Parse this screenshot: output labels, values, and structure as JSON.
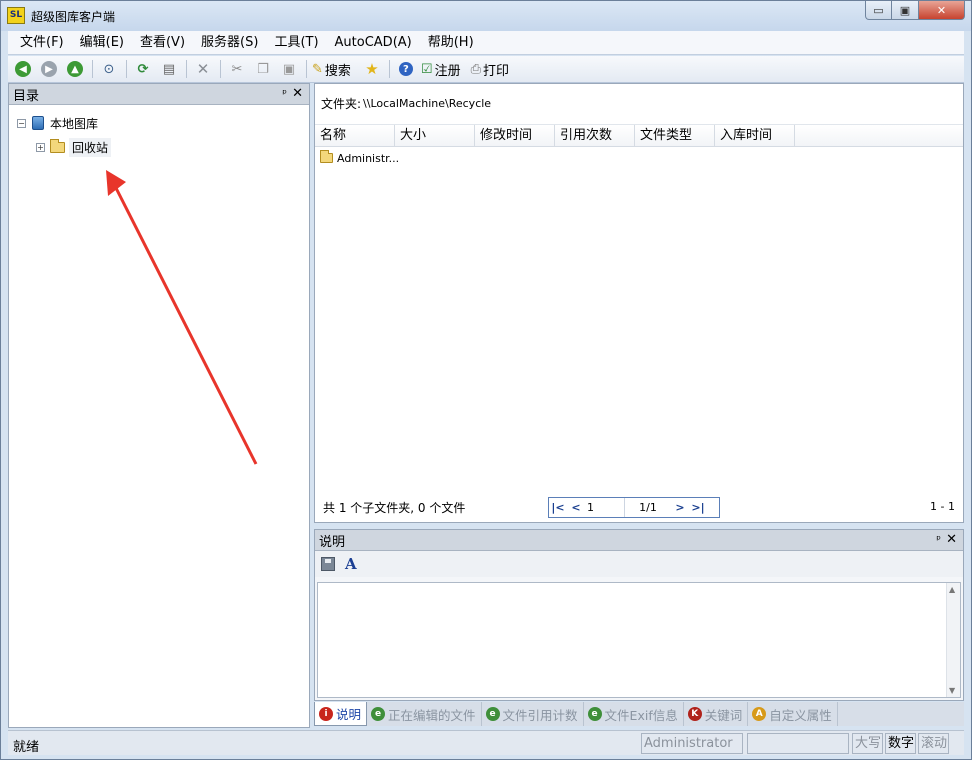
{
  "window": {
    "title": "超级图库客户端",
    "app_icon_text": "SL",
    "min_glyph": "▭",
    "max_glyph": "▣",
    "close_glyph": "✕"
  },
  "menu": [
    "文件(F)",
    "编辑(E)",
    "查看(V)",
    "服务器(S)",
    "工具(T)",
    "AutoCAD(A)",
    "帮助(H)"
  ],
  "toolbar": {
    "icons": [
      "back-icon",
      "forward-icon",
      "up-icon",
      "binoculars-icon",
      "refresh-icon",
      "properties-icon",
      "delete-icon",
      "cut-icon",
      "copy-icon",
      "paste-icon",
      "search-icon",
      "favorite-star-icon",
      "help-icon",
      "register-icon",
      "print-icon"
    ],
    "search_label": "搜索",
    "register_label": "注册",
    "print_label": "打印"
  },
  "tree_pane": {
    "title": "目录",
    "pin": "ᵖ",
    "close": "✕",
    "items": [
      {
        "label": "本地图库",
        "expander": "−"
      },
      {
        "label": "回收站",
        "expander": "+"
      }
    ]
  },
  "browser": {
    "path_label": "文件夹:",
    "path_value": "\\\\LocalMachine\\Recycle",
    "columns": [
      "名称",
      "大小",
      "修改时间",
      "引用次数",
      "文件类型",
      "入库时间"
    ],
    "rows": [
      {
        "name": "Administr..."
      }
    ],
    "summary": "共 1 个子文件夹, 0 个文件",
    "pager": {
      "current_page": "1",
      "page_count": "1/1"
    },
    "range": "1 - 1"
  },
  "description_pane": {
    "title": "说明",
    "pin": "ᵖ",
    "close": "✕",
    "font_button": "A"
  },
  "tabs": [
    {
      "label": "说明",
      "icon": "info-icon",
      "icon_char": "i",
      "color": "#c8251c",
      "active": true
    },
    {
      "label": "正在编辑的文件",
      "icon": "e-icon",
      "icon_char": "e",
      "color": "#3f8f3a",
      "active": false
    },
    {
      "label": "文件引用计数",
      "icon": "e-icon",
      "icon_char": "e",
      "color": "#3f8f3a",
      "active": false
    },
    {
      "label": "文件Exif信息",
      "icon": "e-icon",
      "icon_char": "e",
      "color": "#3f8f3a",
      "active": false
    },
    {
      "label": "关键词",
      "icon": "keyword-icon",
      "icon_char": "K",
      "color": "#b0221b",
      "active": false
    },
    {
      "label": "自定义属性",
      "icon": "attribute-icon",
      "icon_char": "A",
      "color": "#d79a1a",
      "active": false
    }
  ],
  "status": {
    "text": "就绪",
    "user": "Administrator",
    "caps": "大写",
    "num": "数字",
    "scroll": "滚动"
  },
  "colors": {
    "accent": "#1e46a8",
    "annotation_arrow": "#e8352b"
  }
}
